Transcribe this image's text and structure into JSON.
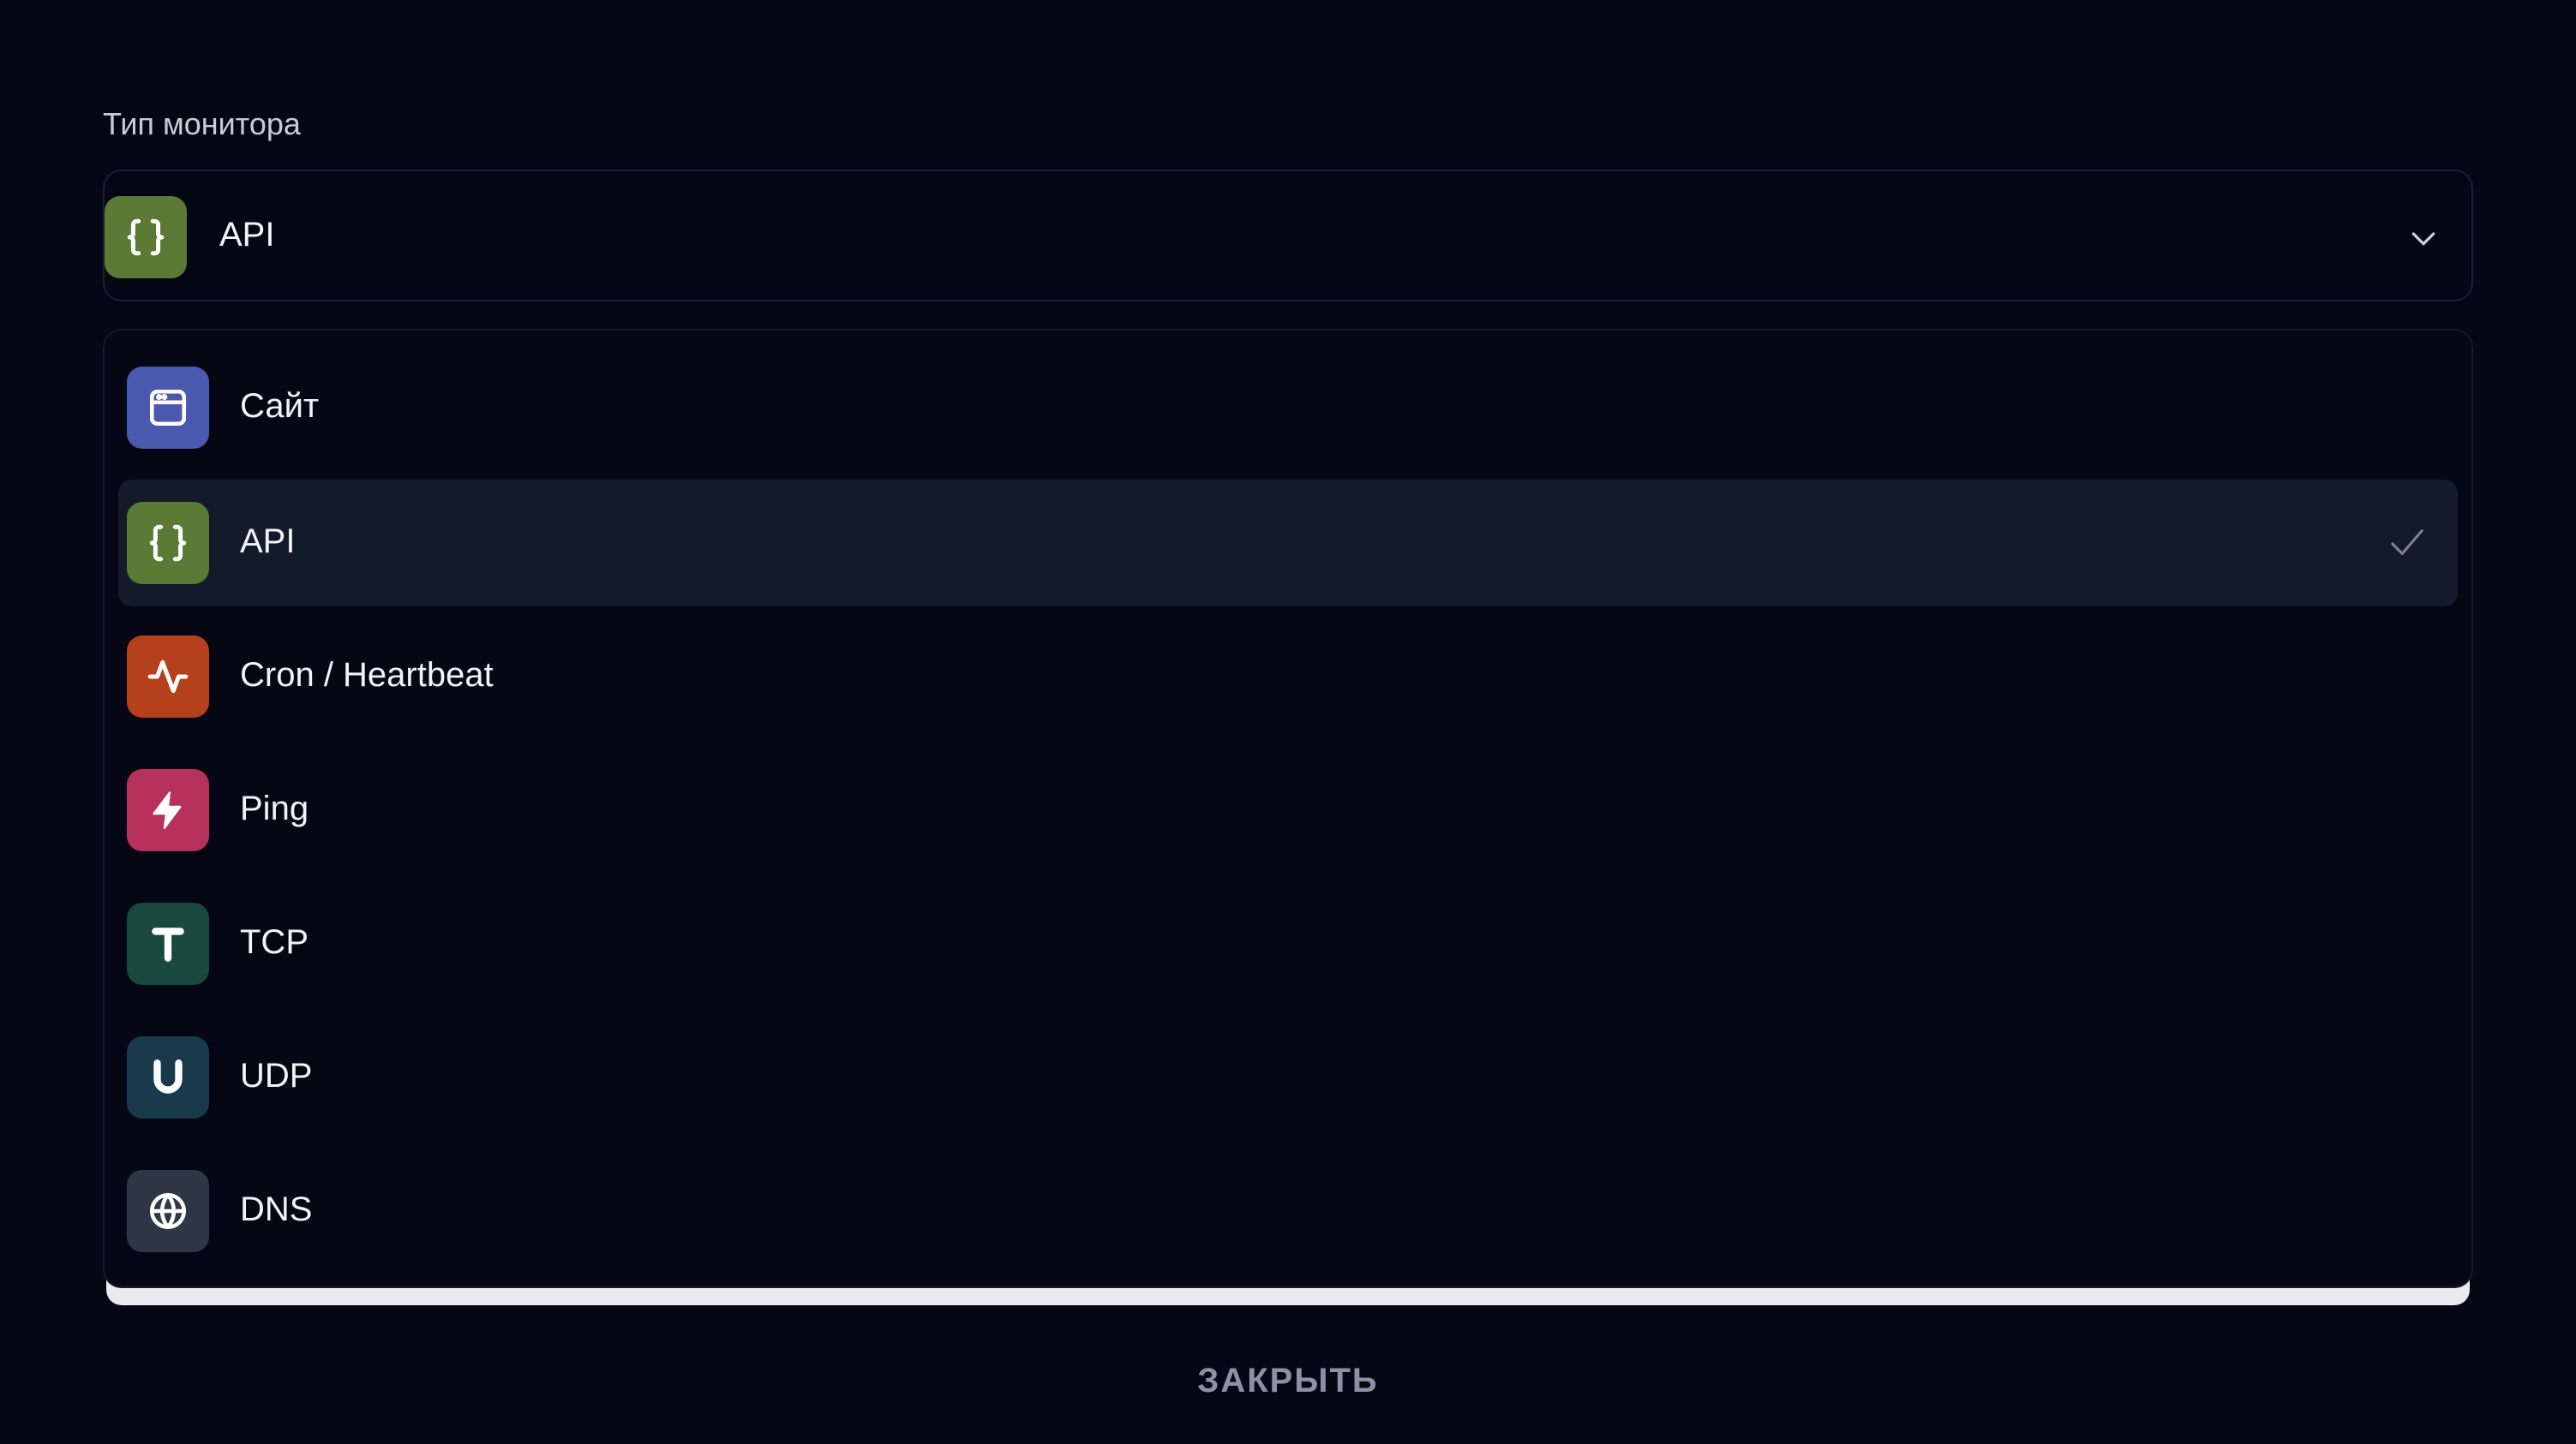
{
  "field": {
    "label": "Тип монитора",
    "selected_value": "API",
    "selected_icon": "braces-icon"
  },
  "options": [
    {
      "label": "Сайт",
      "icon": "browser-window-icon",
      "color": "#4a58ad"
    },
    {
      "label": "API",
      "icon": "braces-icon",
      "color": "#5a7a35",
      "selected": true
    },
    {
      "label": "Cron / Heartbeat",
      "icon": "activity-icon",
      "color": "#b5401b"
    },
    {
      "label": "Ping",
      "icon": "lightning-icon",
      "color": "#b8305c"
    },
    {
      "label": "TCP",
      "icon": "letter-t-icon",
      "color": "#19483d"
    },
    {
      "label": "UDP",
      "icon": "letter-u-icon",
      "color": "#193a4a"
    },
    {
      "label": "DNS",
      "icon": "globe-icon",
      "color": "#2f3747"
    }
  ],
  "footer": {
    "close_label": "ЗАКРЫТЬ"
  }
}
